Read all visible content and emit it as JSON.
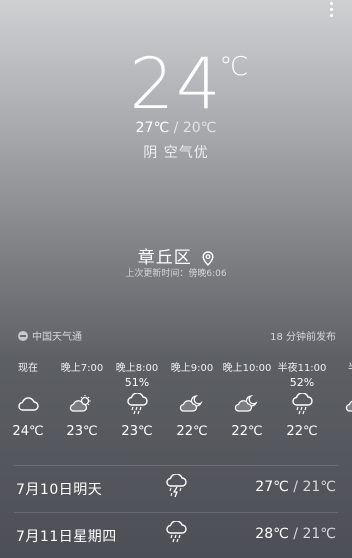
{
  "current": {
    "temperature": "24",
    "unit": "℃",
    "high": "27℃",
    "separator": " / ",
    "low": "20℃",
    "condition": "阴  空气优"
  },
  "location": {
    "name": "章丘区",
    "updated": "上次更新时间：傍晚6:06"
  },
  "source": {
    "name": "中国天气通",
    "published": "18 分钟前发布"
  },
  "hourly": [
    {
      "time": "现在",
      "precip": "",
      "icon": "cloud-icon",
      "temp": "24℃"
    },
    {
      "time": "晚上7:00",
      "precip": "",
      "icon": "partly-cloudy-day-icon",
      "temp": "23℃"
    },
    {
      "time": "晚上8:00",
      "precip": "51%",
      "icon": "rain-icon",
      "temp": "23℃"
    },
    {
      "time": "晚上9:00",
      "precip": "",
      "icon": "partly-cloudy-night-icon",
      "temp": "22℃"
    },
    {
      "time": "晚上10:00",
      "precip": "",
      "icon": "partly-cloudy-night-icon",
      "temp": "22℃"
    },
    {
      "time": "半夜11:00",
      "precip": "52%",
      "icon": "rain-icon",
      "temp": "22℃"
    },
    {
      "time": "半夜",
      "precip": "",
      "icon": "partly-cloudy-night-icon",
      "temp": "2"
    }
  ],
  "daily": [
    {
      "label": "7月10日明天",
      "icon": "thunderstorm-icon",
      "high": "27℃",
      "separator": " / ",
      "low": "21℃"
    },
    {
      "label": "7月11日星期四",
      "icon": "rain-icon",
      "high": "28℃",
      "separator": " / ",
      "low": "21℃"
    }
  ]
}
